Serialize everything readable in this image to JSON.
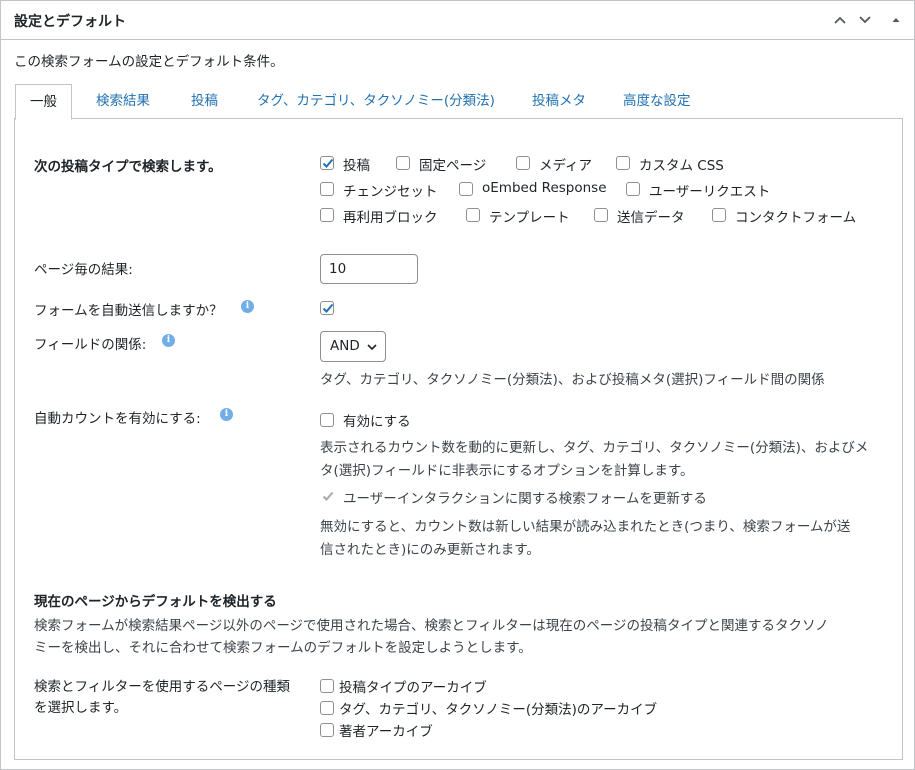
{
  "panel": {
    "title": "設定とデフォルト",
    "description": "この検索フォームの設定とデフォルト条件。"
  },
  "tabs": [
    {
      "label": "一般"
    },
    {
      "label": "検索結果"
    },
    {
      "label": "投稿"
    },
    {
      "label": "タグ、カテゴリ、タクソノミー(分類法)"
    },
    {
      "label": "投稿メタ"
    },
    {
      "label": "高度な設定"
    }
  ],
  "post_types": {
    "label": "次の投稿タイプで検索します。",
    "options": [
      {
        "label": "投稿",
        "checked": true
      },
      {
        "label": "固定ページ",
        "checked": false
      },
      {
        "label": "メディア",
        "checked": false
      },
      {
        "label": "カスタム CSS",
        "checked": false
      },
      {
        "label": "チェンジセット",
        "checked": false
      },
      {
        "label": "oEmbed Response",
        "checked": false
      },
      {
        "label": "ユーザーリクエスト",
        "checked": false
      },
      {
        "label": "再利用ブロック",
        "checked": false
      },
      {
        "label": "テンプレート",
        "checked": false
      },
      {
        "label": "送信データ",
        "checked": false
      },
      {
        "label": "コンタクトフォーム",
        "checked": false
      }
    ]
  },
  "results_per_page": {
    "label": "ページ毎の結果:",
    "value": "10"
  },
  "auto_submit": {
    "label": "フォームを自動送信しますか？",
    "checked": true
  },
  "field_relation": {
    "label": "フィールドの関係:",
    "selected": "AND",
    "help": "タグ、カテゴリ、タクソノミー(分類法)、および投稿メタ(選択)フィールド間の関係"
  },
  "auto_count": {
    "label": "自動カウントを有効にする:",
    "enable_label": "有効にする",
    "enable_help_line1": "表示されるカウント数を動的に更新し、タグ、カテゴリ、タクソノミー(分類法)、およびメ",
    "enable_help_line2": "タ(選択)フィールドに非表示にするオプションを計算します。",
    "refresh_label": "ユーザーインタラクションに関する検索フォームを更新する",
    "refresh_help_line1": "無効にすると、カウント数は新しい結果が読み込まれたとき(つまり、検索フォームが送",
    "refresh_help_line2": "信されたとき)にのみ更新されます。"
  },
  "detect_defaults": {
    "heading": "現在のページからデフォルトを検出する",
    "description_line1": "検索フォームが検索結果ページ以外のページで使用された場合、検索とフィルターは現在のページの投稿タイプと関連するタクソノ",
    "description_line2": "ミーを検出し、それに合わせて検索フォームのデフォルトを設定しようとします。",
    "page_type_label_line1": "検索とフィルターを使用するページの種類",
    "page_type_label_line2": "を選択します。",
    "options": [
      {
        "label": "投稿タイプのアーカイブ"
      },
      {
        "label": "タグ、カテゴリ、タクソノミー(分類法)のアーカイブ"
      },
      {
        "label": "著者アーカイブ"
      }
    ]
  },
  "icons": {
    "info": "info-icon",
    "move_up": "chevron-up-icon",
    "move_down": "chevron-down-icon",
    "toggle": "triangle-up-icon"
  },
  "colors": {
    "link": "#2271b1",
    "info": "#72aee6",
    "border": "#c3c4c7"
  }
}
